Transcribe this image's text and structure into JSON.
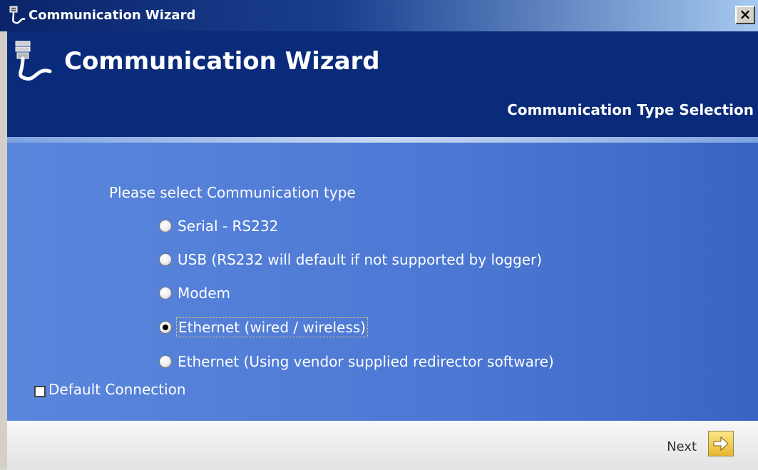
{
  "window": {
    "title": "Communication Wizard",
    "close_label": "×"
  },
  "banner": {
    "title": "Communication Wizard",
    "subtitle": "Communication Type Selection"
  },
  "content": {
    "prompt": "Please select Communication type",
    "options": [
      {
        "label": "Serial - RS232",
        "selected": false
      },
      {
        "label": "USB (RS232 will default if not supported by logger)",
        "selected": false
      },
      {
        "label": "Modem",
        "selected": false
      },
      {
        "label": "Ethernet (wired / wireless)",
        "selected": true
      },
      {
        "label": "Ethernet (Using vendor supplied redirector software)",
        "selected": false
      }
    ],
    "default_connection": {
      "label": "Default Connection",
      "checked": false
    }
  },
  "footer": {
    "next_label": "Next"
  },
  "colors": {
    "banner": "#0a2a7a",
    "content": "#4c78d4",
    "accent": "#e6b630"
  },
  "icons": [
    "serial-cable-icon",
    "next-arrow-icon"
  ]
}
